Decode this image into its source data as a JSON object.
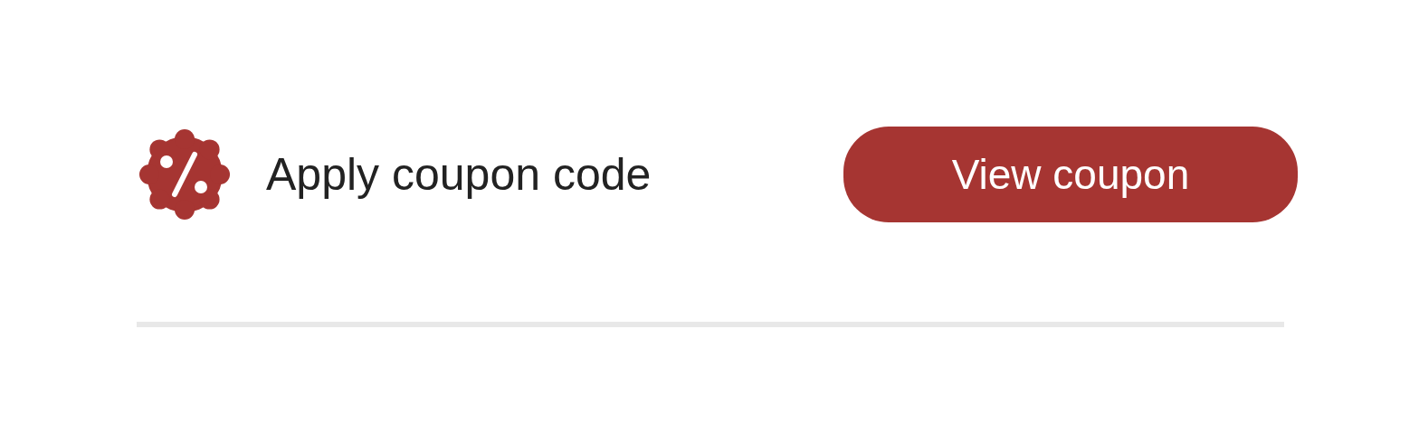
{
  "coupon": {
    "label": "Apply coupon code",
    "button": "View coupon"
  }
}
